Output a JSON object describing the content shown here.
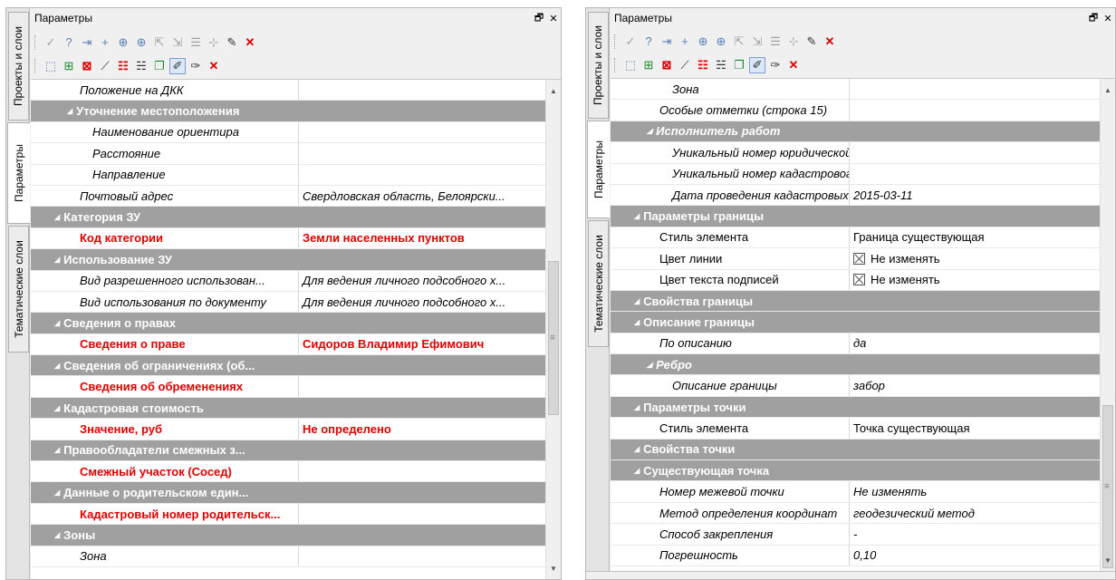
{
  "left_panel": {
    "tabs": [
      "Проекты и слои",
      "Параметры",
      "Тематические слои"
    ],
    "title": "Параметры",
    "rows": [
      {
        "kind": "prop",
        "name": "Положение на ДКК",
        "value": "",
        "indent": 1,
        "style": "it"
      },
      {
        "kind": "cat",
        "name": "Уточнение местоположения",
        "indent": 1
      },
      {
        "kind": "prop",
        "name": "Наименование ориентира",
        "value": "",
        "indent": 2,
        "style": "it"
      },
      {
        "kind": "prop",
        "name": "Расстояние",
        "value": "",
        "indent": 2,
        "style": "it"
      },
      {
        "kind": "prop",
        "name": "Направление",
        "value": "",
        "indent": 2,
        "style": "it"
      },
      {
        "kind": "prop",
        "name": "Почтовый адрес",
        "value": "Свердловская область, Белоярски...",
        "indent": 1,
        "style": "it"
      },
      {
        "kind": "cat",
        "name": "Категория ЗУ",
        "indent": 0
      },
      {
        "kind": "prop",
        "name": "Код категории",
        "value": "Земли населенных пунктов",
        "indent": 1,
        "style": "red"
      },
      {
        "kind": "cat",
        "name": "Использование ЗУ",
        "indent": 0
      },
      {
        "kind": "prop",
        "name": "Вид разрешенного использован...",
        "value": "Для ведения личного подсобного х...",
        "indent": 1,
        "style": "it"
      },
      {
        "kind": "prop",
        "name": "Вид использования по документу",
        "value": "Для ведения личного подсобного х...",
        "indent": 1,
        "style": "it"
      },
      {
        "kind": "cat",
        "name": "Сведения о правах",
        "indent": 0
      },
      {
        "kind": "prop",
        "name": "Сведения о праве",
        "value": "Сидоров Владимир Ефимович",
        "indent": 1,
        "style": "red"
      },
      {
        "kind": "cat",
        "name": "Сведения об ограничениях (об...",
        "indent": 0
      },
      {
        "kind": "prop",
        "name": "Сведения об обременениях",
        "value": "",
        "indent": 1,
        "style": "red"
      },
      {
        "kind": "cat",
        "name": "Кадастровая стоимость",
        "indent": 0
      },
      {
        "kind": "prop",
        "name": "Значение, руб",
        "value": "Не определено",
        "indent": 1,
        "style": "red"
      },
      {
        "kind": "cat",
        "name": "Правообладатели смежных з...",
        "indent": 0
      },
      {
        "kind": "prop",
        "name": "Смежный участок (Сосед)",
        "value": "",
        "indent": 1,
        "style": "red"
      },
      {
        "kind": "cat",
        "name": "Данные о родительском един...",
        "indent": 0
      },
      {
        "kind": "prop",
        "name": "Кадастровый номер родительск...",
        "value": "",
        "indent": 1,
        "style": "red"
      },
      {
        "kind": "cat",
        "name": "Зоны",
        "indent": 0
      },
      {
        "kind": "prop",
        "name": "Зона",
        "value": "",
        "indent": 1,
        "style": "it"
      }
    ]
  },
  "right_panel": {
    "tabs": [
      "Проекты и слои",
      "Параметры",
      "Тематические слои"
    ],
    "title": "Параметры",
    "rows": [
      {
        "kind": "prop",
        "name": "Зона",
        "value": "",
        "indent": 2,
        "style": "it"
      },
      {
        "kind": "prop",
        "name": "Особые отметки (строка 15)",
        "value": "",
        "indent": 1,
        "style": "it"
      },
      {
        "kind": "cat",
        "name": "Исполнитель работ",
        "indent": 1,
        "cat_style": "it"
      },
      {
        "kind": "prop",
        "name": "Уникальный номер юридической...",
        "value": "",
        "indent": 2,
        "style": "it"
      },
      {
        "kind": "prop",
        "name": "Уникальный номер кадастровог...",
        "value": "",
        "indent": 2,
        "style": "it"
      },
      {
        "kind": "prop",
        "name": "Дата проведения кадастровых ...",
        "value": "2015-03-11",
        "indent": 2,
        "style": "it"
      },
      {
        "kind": "cat",
        "name": "Параметры границы",
        "indent": 0
      },
      {
        "kind": "prop",
        "name": "Стиль элемента",
        "value": "Граница существующая",
        "indent": 1,
        "style": "plain"
      },
      {
        "kind": "prop",
        "name": "Цвет линии",
        "value": "Не изменять",
        "indent": 1,
        "style": "plain",
        "check": true
      },
      {
        "kind": "prop",
        "name": "Цвет текста подписей",
        "value": "Не изменять",
        "indent": 1,
        "style": "plain",
        "check": true
      },
      {
        "kind": "cat",
        "name": "Свойства границы",
        "indent": 0
      },
      {
        "kind": "cat",
        "name": "Описание границы",
        "indent": 0
      },
      {
        "kind": "prop",
        "name": "По описанию",
        "value": "да",
        "indent": 1,
        "style": "it"
      },
      {
        "kind": "cat",
        "name": "Ребро",
        "indent": 1,
        "cat_style": "it"
      },
      {
        "kind": "prop",
        "name": "Описание  границы",
        "value": "забор",
        "indent": 2,
        "style": "it"
      },
      {
        "kind": "cat",
        "name": "Параметры точки",
        "indent": 0
      },
      {
        "kind": "prop",
        "name": "Стиль элемента",
        "value": "Точка существующая",
        "indent": 1,
        "style": "plain"
      },
      {
        "kind": "cat",
        "name": "Свойства точки",
        "indent": 0
      },
      {
        "kind": "cat",
        "name": "Существующая точка",
        "indent": 0
      },
      {
        "kind": "prop",
        "name": "Номер межевой точки",
        "value": "Не изменять",
        "indent": 1,
        "style": "it"
      },
      {
        "kind": "prop",
        "name": "Метод определения координат",
        "value": "геодезический метод",
        "indent": 1,
        "style": "it"
      },
      {
        "kind": "prop",
        "name": "Способ закрепления",
        "value": "-",
        "indent": 1,
        "style": "it"
      },
      {
        "kind": "prop",
        "name": "Погрешность",
        "value": "0,10",
        "indent": 1,
        "style": "it"
      }
    ]
  },
  "icons": {
    "toolbar1": [
      {
        "name": "apply-check-icon",
        "glyph": "✓",
        "tone": "gray"
      },
      {
        "name": "help-icon",
        "glyph": "?",
        "tone": "blue"
      },
      {
        "name": "step-icon",
        "glyph": "⇥",
        "tone": "blue"
      },
      {
        "name": "add-point-icon",
        "glyph": "+",
        "tone": "blue"
      },
      {
        "name": "crosshair-icon",
        "glyph": "⊕",
        "tone": "blue"
      },
      {
        "name": "snap-point-icon",
        "glyph": "⊕",
        "tone": "blue"
      },
      {
        "name": "select-arrow-icon",
        "glyph": "⇱",
        "tone": "gray"
      },
      {
        "name": "select-text-icon",
        "glyph": "⇲",
        "tone": "gray"
      },
      {
        "name": "filter-icon",
        "glyph": "☰",
        "tone": "gray"
      },
      {
        "name": "node-icon",
        "glyph": "⊹",
        "tone": "gray"
      },
      {
        "name": "pipette-icon",
        "glyph": "✎",
        "tone": "dark"
      },
      {
        "name": "close-red-icon",
        "glyph": "✕",
        "tone": "red"
      }
    ],
    "toolbar2": [
      {
        "name": "pick-object-icon",
        "glyph": "⬚",
        "tone": "blue"
      },
      {
        "name": "add-vertex-icon",
        "glyph": "⊞",
        "tone": "green"
      },
      {
        "name": "remove-vertex-icon",
        "glyph": "⊠",
        "tone": "red"
      },
      {
        "name": "edit-geometry-icon",
        "glyph": "⟋",
        "tone": "dark"
      },
      {
        "name": "table-icon",
        "glyph": "☷",
        "tone": "red"
      },
      {
        "name": "table-props-icon",
        "glyph": "☵",
        "tone": "dark"
      },
      {
        "name": "layers-icon",
        "glyph": "❐",
        "tone": "green"
      },
      {
        "name": "edit-active-icon",
        "glyph": "✐",
        "tone": "dark",
        "pressed": true
      },
      {
        "name": "properties-icon",
        "glyph": "✑",
        "tone": "dark"
      },
      {
        "name": "delete-icon",
        "glyph": "✕",
        "tone": "red"
      }
    ]
  }
}
